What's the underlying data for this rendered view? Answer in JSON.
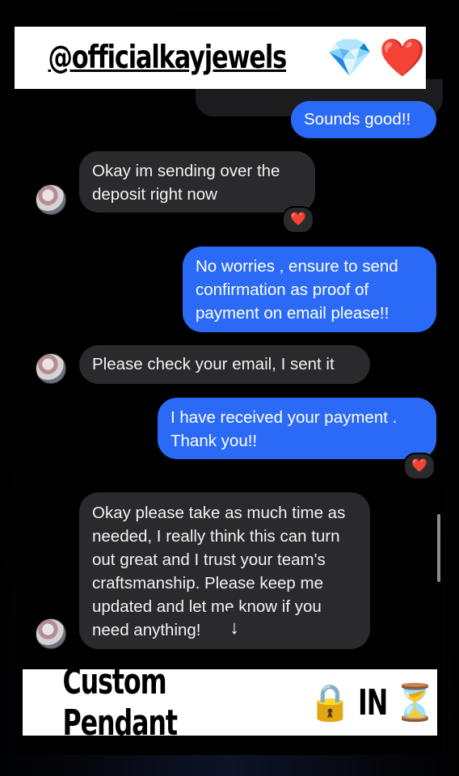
{
  "top_banner": {
    "handle": "@officialkayjewels",
    "emojis": [
      "💎",
      "❤️"
    ]
  },
  "messages": [
    {
      "from": "me",
      "text": "Sounds good!!"
    },
    {
      "from": "them",
      "text": "Okay im sending over the deposit right now",
      "reaction": "❤️"
    },
    {
      "from": "me",
      "text": "No worries , ensure to send confirmation as proof of payment on email please!!"
    },
    {
      "from": "them",
      "text": "Please check your email, I sent it"
    },
    {
      "from": "me",
      "text": "I have received your payment . Thank you!!",
      "reaction": "❤️"
    },
    {
      "from": "them",
      "text": "Okay please take as much time as needed, I really think this can turn out great and I trust your team's craftsmanship. Please keep me updated and let me know if you need anything!"
    }
  ],
  "scroll_down_icon": "↓",
  "bottom_banner": {
    "text": "Custom Pendant",
    "lock_emoji": "🔒",
    "status": "IN",
    "hourglass_emoji": "⏳"
  }
}
